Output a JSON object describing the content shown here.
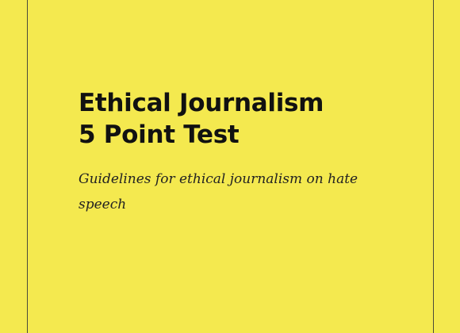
{
  "cover": {
    "title_line_1": "Ethical Journalism",
    "title_line_2": "5 Point Test",
    "subtitle": "Guidelines for ethical journalism on hate speech"
  },
  "colors": {
    "background": "#f4e94f",
    "rule": "#4a4a3a",
    "text": "#111111"
  }
}
